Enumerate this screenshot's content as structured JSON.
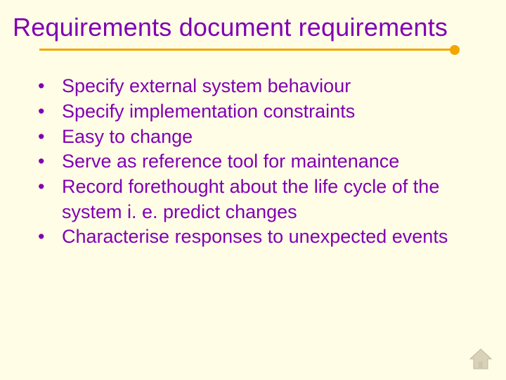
{
  "title": "Requirements document requirements",
  "bullets": [
    "Specify external system behaviour",
    "Specify implementation constraints",
    "Easy to change",
    "Serve as reference tool for maintenance",
    "Record forethought about the life cycle of the system i. e. predict changes",
    "Characterise responses to unexpected events"
  ]
}
